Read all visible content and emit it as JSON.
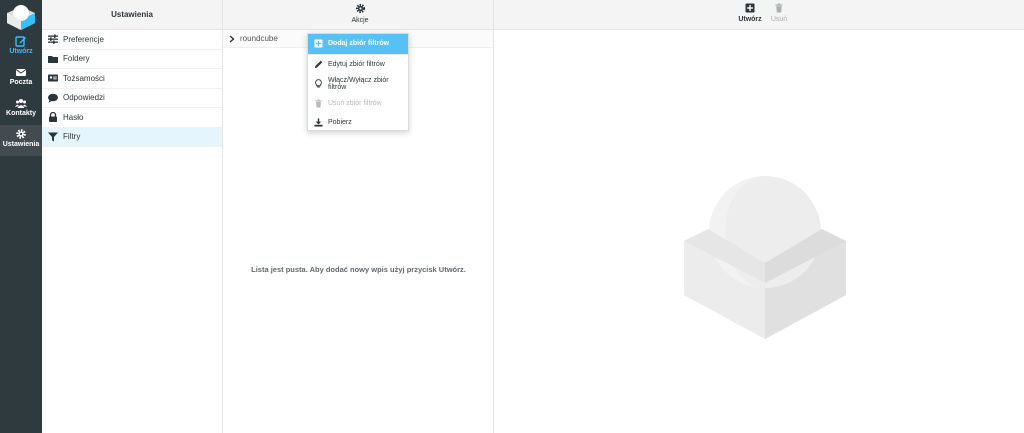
{
  "rail": {
    "items": [
      {
        "label": "Utwórz",
        "icon": "compose-icon"
      },
      {
        "label": "Poczta",
        "icon": "mail-icon"
      },
      {
        "label": "Kontakty",
        "icon": "contacts-icon"
      },
      {
        "label": "Ustawienia",
        "icon": "settings-gear-icon"
      }
    ],
    "active_color": "#37beff",
    "background": "#2f3a3f"
  },
  "settings_panel": {
    "title": "Ustawienia",
    "items": [
      {
        "label": "Preferencje",
        "icon": "sliders-icon"
      },
      {
        "label": "Foldery",
        "icon": "folder-icon"
      },
      {
        "label": "Tożsamości",
        "icon": "id-card-icon"
      },
      {
        "label": "Odpowiedzi",
        "icon": "comment-icon"
      },
      {
        "label": "Hasło",
        "icon": "lock-icon"
      },
      {
        "label": "Filtry",
        "icon": "filter-icon",
        "selected": true
      }
    ]
  },
  "filters_panel": {
    "actions_label": "Akcje",
    "filter_set": "roundcube",
    "empty_message": "Lista jest pusta. Aby dodać nowy wpis użyj przycisk Utwórz."
  },
  "actions_menu": {
    "items": [
      {
        "label": "Dodaj zbiór filtrów",
        "icon": "plus-square-icon",
        "state": "active"
      },
      {
        "label": "Edytuj zbiór filtrów",
        "icon": "pencil-icon",
        "state": "normal"
      },
      {
        "label": "Włącz/Wyłącz zbiór filtrów",
        "icon": "lightbulb-icon",
        "state": "normal"
      },
      {
        "label": "Usuń zbiór filtrów",
        "icon": "trash-icon",
        "state": "disabled"
      },
      {
        "label": "Pobierz",
        "icon": "download-icon",
        "state": "normal"
      }
    ],
    "highlight_color": "#57c0f4"
  },
  "content_toolbar": {
    "create_label": "Utwórz",
    "delete_label": "Usuń"
  }
}
